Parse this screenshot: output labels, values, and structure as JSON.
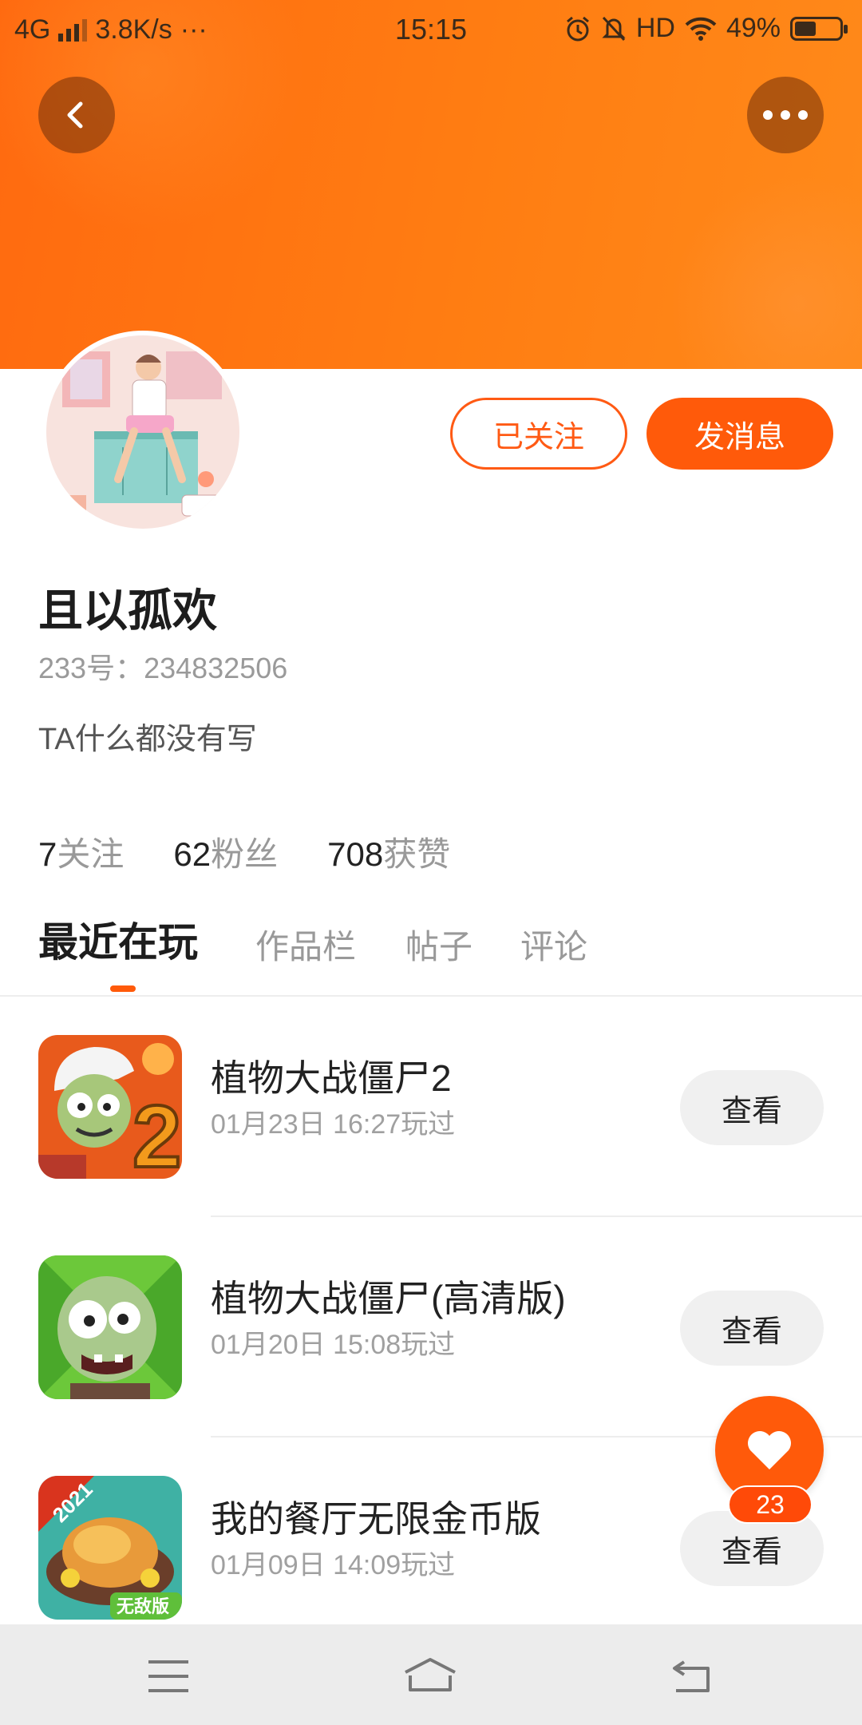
{
  "status_bar": {
    "network": "4G",
    "speed": "3.8K/s",
    "more": "···",
    "time": "15:15",
    "hd": "HD",
    "battery_text": "49%",
    "battery_level": 0.49
  },
  "colors": {
    "accent": "#ff5a0a",
    "header_start": "#ff6a10",
    "header_end": "#ff8a1a"
  },
  "profile": {
    "buttons": {
      "follow_label": "已关注",
      "message_label": "发消息"
    },
    "username": "且以孤欢",
    "uid": "233号：234832506",
    "bio": "TA什么都没有写",
    "stats": {
      "following_num": "7",
      "following_label": "关注",
      "fans_num": "62",
      "fans_label": "粉丝",
      "likes_num": "708",
      "likes_label": "获赞"
    }
  },
  "tabs": [
    {
      "label": "最近在玩",
      "active": true
    },
    {
      "label": "作品栏"
    },
    {
      "label": "帖子"
    },
    {
      "label": "评论"
    }
  ],
  "games": [
    {
      "title": "植物大战僵尸2",
      "time": "01月23日 16:27玩过",
      "button": "查看"
    },
    {
      "title": "植物大战僵尸(高清版)",
      "time": "01月20日 15:08玩过",
      "button": "查看"
    },
    {
      "title": "我的餐厅无限金币版",
      "time": "01月09日 14:09玩过",
      "button": "查看",
      "icon_year": "2021",
      "icon_tag": "无敌版"
    }
  ],
  "fab": {
    "icon": "heart-icon",
    "count": "23"
  },
  "nav": {
    "icons": [
      "menu-icon",
      "home-icon",
      "back-icon"
    ]
  }
}
